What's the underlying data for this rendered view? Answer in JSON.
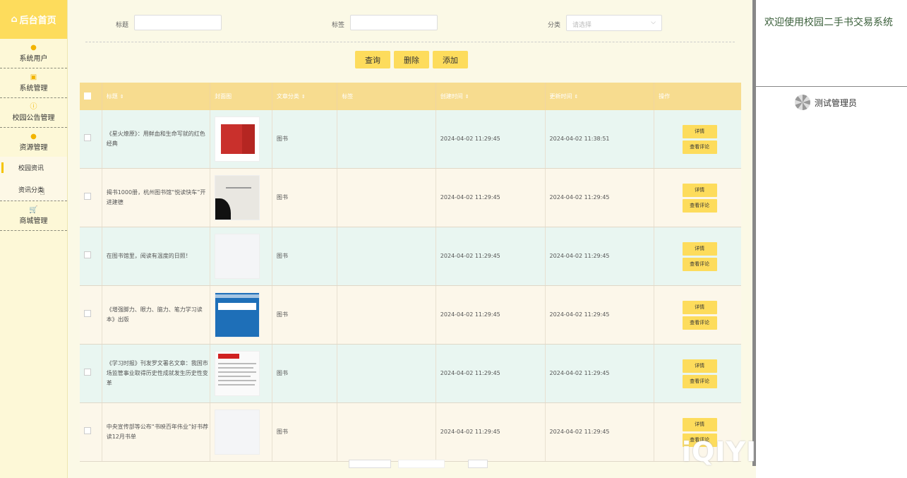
{
  "sidebar": {
    "home": "后台首页",
    "groups": [
      {
        "label": "系统用户"
      },
      {
        "label": "系统管理"
      },
      {
        "label": "校园公告管理"
      },
      {
        "label": "资源管理"
      }
    ],
    "sub_items": [
      {
        "label": "校园资讯",
        "active": true
      },
      {
        "label": "资讯分类",
        "active": false
      }
    ],
    "mall": "商城管理"
  },
  "search": {
    "title_label": "标题",
    "tag_label": "标签",
    "category_label": "分类",
    "category_placeholder": "请选择"
  },
  "buttons": {
    "query": "查询",
    "delete": "删除",
    "add": "添加"
  },
  "table": {
    "headers": [
      "标题",
      "封面图",
      "文章分类",
      "标签",
      "创建时间",
      "更新时间",
      "操作"
    ],
    "rows": [
      {
        "title": "《星火燎原》：用鲜血和生命写就的红色经典",
        "category": "图书",
        "tag": "",
        "created": "2024-04-02 11:29:45",
        "updated": "2024-04-02 11:38:51"
      },
      {
        "title": "揭书1000册，杭州图书馆“悦读快车”开进建德",
        "category": "图书",
        "tag": "",
        "created": "2024-04-02 11:29:45",
        "updated": "2024-04-02 11:29:45"
      },
      {
        "title": "在图书馆里，阅读有温度的日照！",
        "category": "图书",
        "tag": "",
        "created": "2024-04-02 11:29:45",
        "updated": "2024-04-02 11:29:45"
      },
      {
        "title": "《增强脚力、眼力、脑力、笔力学习读本》出版",
        "category": "图书",
        "tag": "",
        "created": "2024-04-02 11:29:45",
        "updated": "2024-04-02 11:29:45"
      },
      {
        "title": "《学习时报》刊发罗文署名文章：我国市场监管事业取得历史性成就发生历史性变革",
        "category": "图书",
        "tag": "",
        "created": "2024-04-02 11:29:45",
        "updated": "2024-04-02 11:29:45"
      },
      {
        "title": "中央宣传部等公布“书映百年伟业”好书荐读12月书单",
        "category": "图书",
        "tag": "",
        "created": "2024-04-02 11:29:45",
        "updated": "2024-04-02 11:29:45"
      }
    ],
    "detail_label": "详情",
    "comments_label": "查看评论"
  },
  "right": {
    "welcome": "欢迎使用校园二手书交易系统",
    "username": "测试管理员"
  },
  "watermark": "iQIYI"
}
